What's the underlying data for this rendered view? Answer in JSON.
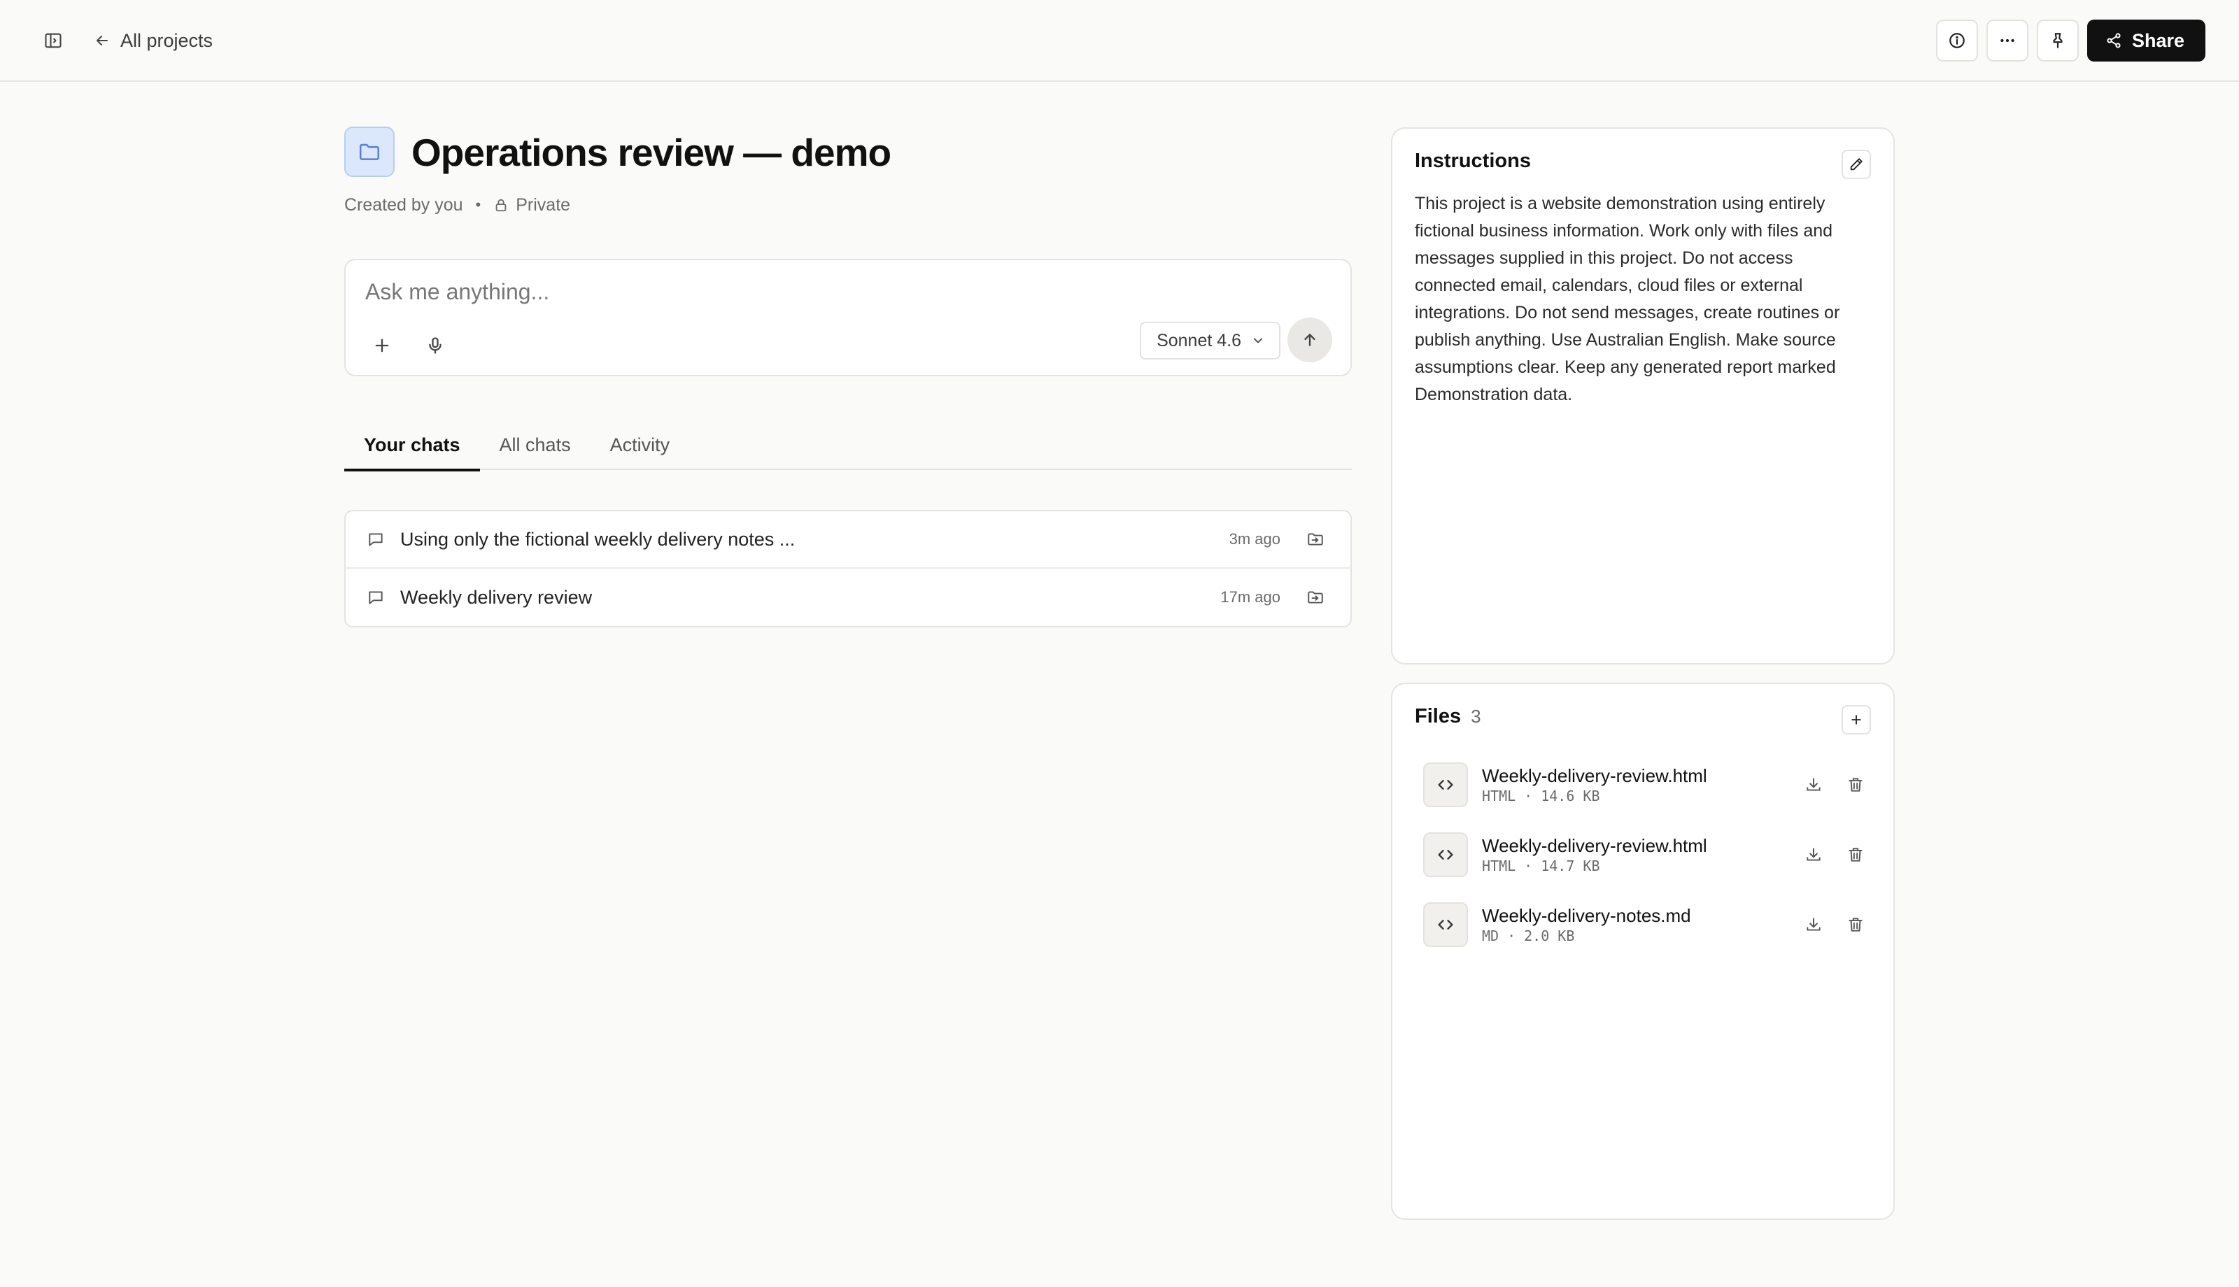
{
  "topbar": {
    "back_label": "All projects",
    "share_label": "Share"
  },
  "project": {
    "title": "Operations review — demo",
    "created_by": "Created by you",
    "separator": "•",
    "visibility": "Private"
  },
  "composer": {
    "placeholder": "Ask me anything...",
    "model": "Sonnet 4.6"
  },
  "tabs": [
    {
      "label": "Your chats",
      "active": true
    },
    {
      "label": "All chats",
      "active": false
    },
    {
      "label": "Activity",
      "active": false
    }
  ],
  "chats": [
    {
      "title": "Using only the fictional weekly delivery notes ...",
      "time": "3m ago"
    },
    {
      "title": "Weekly delivery review",
      "time": "17m ago"
    }
  ],
  "instructions": {
    "title": "Instructions",
    "text": "This project is a website demonstration using entirely fictional business information. Work only with files and messages supplied in this project. Do not access connected email, calendars, cloud files or external integrations. Do not send messages, create routines or publish anything. Use Australian English. Make source assumptions clear. Keep any generated report marked Demonstration data."
  },
  "files": {
    "title": "Files",
    "count": "3",
    "items": [
      {
        "name": "Weekly-delivery-review.html",
        "type": "HTML",
        "dot": "·",
        "size": "14.6 KB"
      },
      {
        "name": "Weekly-delivery-review.html",
        "type": "HTML",
        "dot": "·",
        "size": "14.7 KB"
      },
      {
        "name": "Weekly-delivery-notes.md",
        "type": "MD",
        "dot": "·",
        "size": "2.0 KB"
      }
    ]
  },
  "icons": {
    "sidebar": "sidebar-toggle-icon",
    "back": "arrow-left-icon",
    "info": "info-icon",
    "more": "more-horizontal-icon",
    "pin": "pin-icon",
    "share": "share-icon",
    "folder": "folder-icon",
    "lock": "lock-icon",
    "plus": "plus-icon",
    "mic": "microphone-icon",
    "chevron": "chevron-down-icon",
    "send": "arrow-up-icon",
    "chat": "chat-bubble-icon",
    "move": "folder-move-icon",
    "edit": "pencil-icon",
    "code": "code-icon",
    "download": "download-icon",
    "trash": "trash-icon"
  },
  "colors": {
    "background": "#fafaf9",
    "primary_button": "#111111",
    "project_icon_bg": "#dbe7fb",
    "project_icon_stroke": "#5b82d6"
  }
}
